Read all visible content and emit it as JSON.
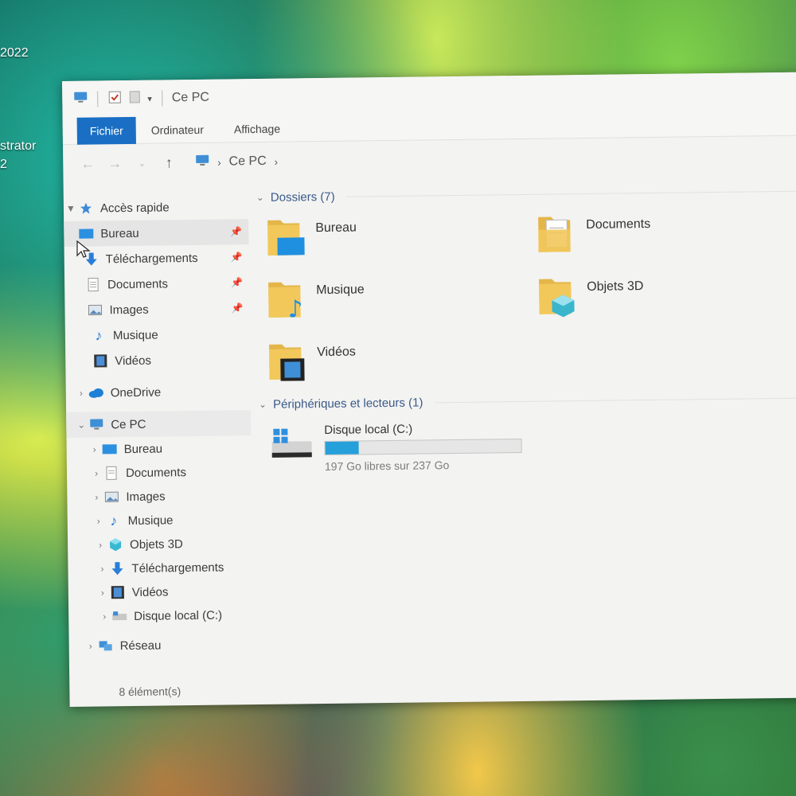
{
  "desktop": {
    "year_fragment": "2022",
    "label_fragment": "strator",
    "number_fragment": "2"
  },
  "window": {
    "title": "Ce PC",
    "ribbon_tabs": [
      "Fichier",
      "Ordinateur",
      "Affichage"
    ],
    "address": {
      "crumb": "Ce PC"
    }
  },
  "sidebar": {
    "quick_access": {
      "label": "Accès rapide",
      "items": [
        {
          "label": "Bureau",
          "icon": "desktop-icon"
        },
        {
          "label": "Téléchargements",
          "icon": "download-icon"
        },
        {
          "label": "Documents",
          "icon": "document-icon"
        },
        {
          "label": "Images",
          "icon": "image-icon"
        },
        {
          "label": "Musique",
          "icon": "music-icon"
        },
        {
          "label": "Vidéos",
          "icon": "video-icon"
        }
      ]
    },
    "onedrive": {
      "label": "OneDrive"
    },
    "this_pc": {
      "label": "Ce PC",
      "items": [
        {
          "label": "Bureau"
        },
        {
          "label": "Documents"
        },
        {
          "label": "Images"
        },
        {
          "label": "Musique"
        },
        {
          "label": "Objets 3D"
        },
        {
          "label": "Téléchargements"
        },
        {
          "label": "Vidéos"
        },
        {
          "label": "Disque local (C:)"
        }
      ]
    },
    "network": {
      "label": "Réseau"
    }
  },
  "content": {
    "folders_group": "Dossiers (7)",
    "folders": [
      {
        "name": "Bureau"
      },
      {
        "name": "Documents"
      },
      {
        "name": "Musique"
      },
      {
        "name": "Objets 3D"
      },
      {
        "name": "Vidéos"
      }
    ],
    "devices_group": "Périphériques et lecteurs (1)",
    "drive": {
      "name": "Disque local (C:)",
      "space": "197 Go libres sur 237 Go",
      "used_fraction": 0.17
    }
  },
  "status": {
    "count": "8 élément(s)"
  },
  "colors": {
    "accent": "#1a6fc4",
    "folder": "#e8b84a",
    "drive_fill": "#26a0da"
  }
}
